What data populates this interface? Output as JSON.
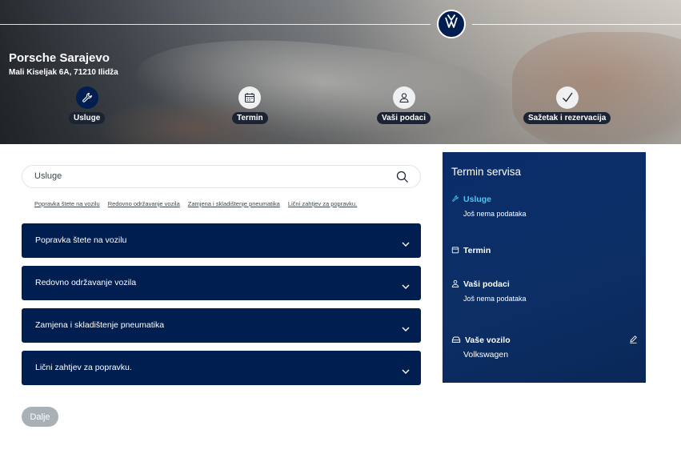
{
  "dealer": {
    "name": "Porsche Sarajevo",
    "address": "Mali Kiseljak 6A, 71210 Ilidža"
  },
  "steps": [
    {
      "label": "Usluge",
      "icon": "wrench-icon",
      "active": true
    },
    {
      "label": "Termin",
      "icon": "calendar-icon",
      "active": false
    },
    {
      "label": "Vaši podaci",
      "icon": "user-icon",
      "active": false
    },
    {
      "label": "Sažetak i rezervacija",
      "icon": "checkmark-icon",
      "active": false
    }
  ],
  "search": {
    "placeholder": "Usluge"
  },
  "quick_links": [
    "Popravka štete na vozilu",
    "Redovno održavanje vozila",
    "Zamjena i skladištenje pneumatika",
    "Lični zahtjev za popravku."
  ],
  "accordions": [
    {
      "title": "Popravka štete na vozilu"
    },
    {
      "title": "Redovno održavanje vozila"
    },
    {
      "title": "Zamjena i skladištenje pneumatika"
    },
    {
      "title": "Lični zahtjev za popravku."
    }
  ],
  "next_button": "Dalje",
  "sidebar": {
    "heading": "Termin servisa",
    "services": {
      "label": "Usluge",
      "value": "Još nema podataka"
    },
    "appointment": {
      "label": "Termin"
    },
    "personal": {
      "label": "Vaši podaci",
      "value": "Još nema podataka"
    },
    "vehicle": {
      "label": "Vaše vozilo",
      "value": "Volkswagen"
    }
  },
  "colors": {
    "brand_navy": "#001e50",
    "sidebar_blue": "#0c2f66",
    "accent_cyan": "#4cc7f4",
    "disabled_gray": "#a9b1b6"
  }
}
